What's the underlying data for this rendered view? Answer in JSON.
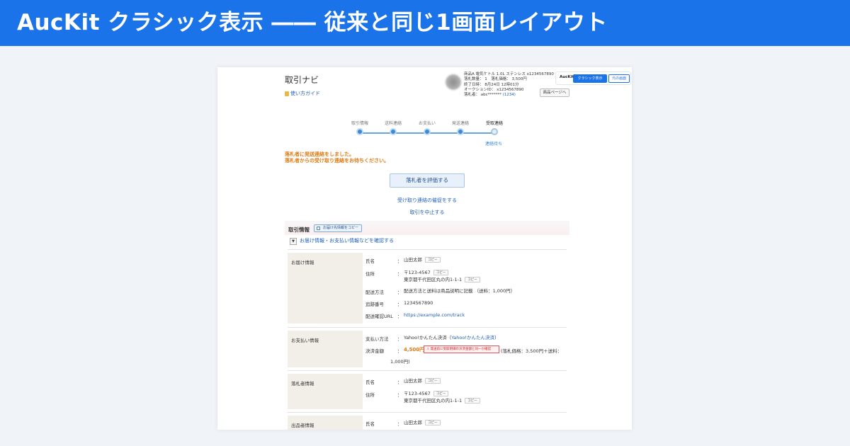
{
  "banner": {
    "title": "AucKit クラシック表示 ―― 従来と同じ1画面レイアウト"
  },
  "header": {
    "title": "取引ナビ",
    "guide": "使い方ガイド",
    "item_lines": [
      "商品A 電気ケトル 1.0L ステンレス x1234567890",
      "落札数量： 1　落札価格： 3,500円",
      "終了日時： 8月24日 12時01分",
      "オークションID： x1234567890"
    ],
    "winner_prefix": "落札者： abc******* ",
    "winner_score": "(1234)",
    "auckit_label": "AucKit",
    "classic_button": "クラシック表示",
    "original_button": "元の画面",
    "item_page_button": "商品ページへ"
  },
  "steps": [
    {
      "label": "取引情報",
      "current": false
    },
    {
      "label": "送料連絡",
      "current": false
    },
    {
      "label": "お支払い",
      "current": false
    },
    {
      "label": "発送連絡",
      "current": false
    },
    {
      "label": "受取連絡",
      "current": true
    }
  ],
  "step_status": "連絡待ち",
  "notice": {
    "line1": "落札者に発送連絡をしました。",
    "line2": "落札者からの受け取り連絡をお待ちください。"
  },
  "actions": {
    "evaluate": "落札者を評価する",
    "remind": "受け取り連絡の催促をする",
    "cancel": "取引を中止する"
  },
  "trade": {
    "heading": "取引情報",
    "copy_dest": "お届け先情報をコピー",
    "toggle_symbol": "▼",
    "toggle_text": "お届け情報・お支払い情報などを確認する"
  },
  "copy_label": "コピー",
  "colon": "：",
  "delivery": {
    "section": "お届け情報",
    "name_label": "氏名",
    "name": "山田太郎",
    "address_label": "住所",
    "zip": "〒123-4567",
    "address": "東京都千代田区丸の内1-1-1",
    "method_label": "配送方法",
    "method": "配送方法と送料は商品説明に記載 （送料：1,000円）",
    "tracking_label": "追跡番号",
    "tracking": "1234567890",
    "url_label": "配送確認URL",
    "url": "https://example.com/track"
  },
  "payment": {
    "section": "お支払い情報",
    "method_label": "支払い方法",
    "method_prefix": "Yahoo!かんたん決済（",
    "method_link": "Yahoo!かんたん決済",
    "method_suffix": "）",
    "amount_label": "決済金額",
    "amount": "4,500円",
    "warning": "⚠ 発送前に受取明細の決済金額と同一か確認",
    "breakdown": "(落札価格：3,500円＋送料：",
    "breakdown2": "1,000円)"
  },
  "winner": {
    "section": "落札者情報",
    "name_label": "氏名",
    "name": "山田太郎",
    "address_label": "住所",
    "zip": "〒123-4567",
    "address": "東京都千代田区丸の内1-1-1"
  },
  "seller": {
    "section": "出品者情報",
    "name_label": "氏名",
    "name": "山田太郎"
  }
}
